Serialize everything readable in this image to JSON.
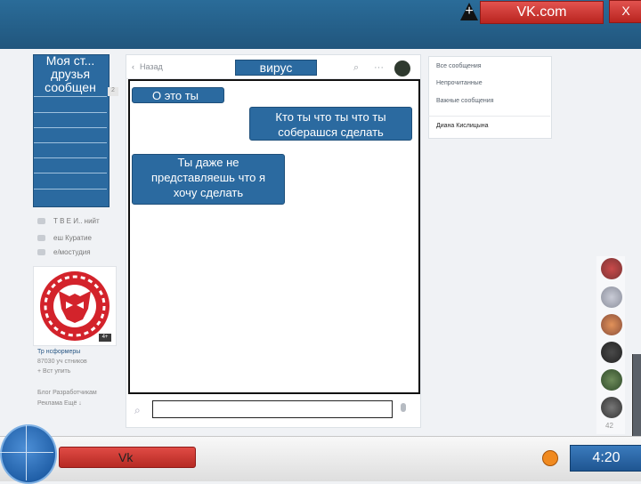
{
  "window": {
    "plus": "+",
    "url": "VK.com",
    "close": "X"
  },
  "menu": {
    "items": [
      "Моя ст...",
      "друзья",
      "сообщен"
    ],
    "badge": "2"
  },
  "sidebar_links": [
    {
      "label": "Т В Е И.. нийт"
    },
    {
      "label": "еш Куратие"
    },
    {
      "label": "е/мостудия"
    }
  ],
  "community": {
    "badge": "4+",
    "name": "Тр нсформеры",
    "members": "87030 уч стников",
    "subscribe": "+ Вст упить",
    "footer1": "Блог   Разработчикам",
    "footer2": "Реклама   Ещё ↓"
  },
  "chat": {
    "back": "Назад",
    "title": "вирус",
    "messages": [
      {
        "text": "О это ты",
        "side": "left"
      },
      {
        "text": "Кто ты что ты что ты соберашся сделать",
        "side": "right"
      },
      {
        "text": "Ты даже не представляешь что я хочу сделать",
        "side": "left"
      }
    ],
    "composer_placeholder": ""
  },
  "folders": {
    "items": [
      "Все сообщения",
      "Непрочитанные",
      "Важные сообщения",
      "Диана Кислицына"
    ]
  },
  "online": {
    "count": "42"
  },
  "taskbar": {
    "vk_label": "Vk",
    "time": "4:20"
  },
  "colors": {
    "accent": "#2b6aa0",
    "red": "#c9302c",
    "orange": "#f08a20"
  }
}
